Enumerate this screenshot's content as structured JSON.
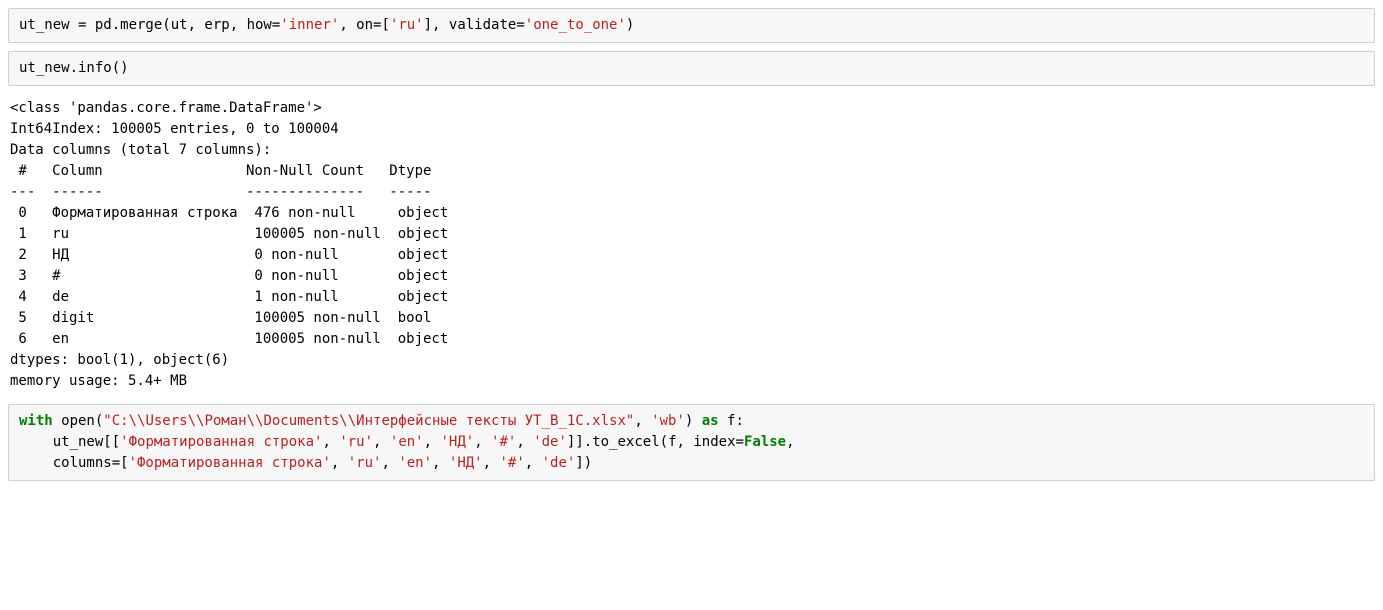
{
  "cell1": {
    "code": {
      "prefix": "ut_new = pd.merge(ut, erp, how=",
      "str1": "'inner'",
      "mid1": ", on=[",
      "str2": "'ru'",
      "mid2": "], validate=",
      "str3": "'one_to_one'",
      "suffix": ")"
    }
  },
  "cell2": {
    "code": "ut_new.info()"
  },
  "output": {
    "lines": [
      "<class 'pandas.core.frame.DataFrame'>",
      "Int64Index: 100005 entries, 0 to 100004",
      "Data columns (total 7 columns):",
      " #   Column                 Non-Null Count   Dtype ",
      "---  ------                 --------------   ----- ",
      " 0   Форматированная строка  476 non-null     object",
      " 1   ru                      100005 non-null  object",
      " 2   НД                      0 non-null       object",
      " 3   #                       0 non-null       object",
      " 4   de                      1 non-null       object",
      " 5   digit                   100005 non-null  bool  ",
      " 6   en                      100005 non-null  object",
      "dtypes: bool(1), object(6)",
      "memory usage: 5.4+ MB"
    ]
  },
  "cell3": {
    "line1": {
      "kw1": "with",
      "sp1": " open(",
      "str1": "\"C:\\\\Users\\\\Роман\\\\Documents\\\\Интерфейсные тексты УТ_В_1С.xlsx\"",
      "sp2": ", ",
      "str2": "'wb'",
      "sp3": ") ",
      "kw2": "as",
      "sp4": " f:"
    },
    "line2": {
      "prefix": "    ut_new[[",
      "s1": "'Форматированная строка'",
      "c1": ", ",
      "s2": "'ru'",
      "c2": ", ",
      "s3": "'en'",
      "c3": ", ",
      "s4": "'НД'",
      "c4": ", ",
      "s5": "'#'",
      "c5": ", ",
      "s6": "'de'",
      "mid": "]].to_excel(f, index=",
      "bool": "False",
      "suffix": ","
    },
    "line3": {
      "prefix": "    columns=[",
      "s1": "'Форматированная строка'",
      "c1": ", ",
      "s2": "'ru'",
      "c2": ", ",
      "s3": "'en'",
      "c3": ", ",
      "s4": "'НД'",
      "c4": ", ",
      "s5": "'#'",
      "c5": ", ",
      "s6": "'de'",
      "suffix": "])"
    }
  }
}
